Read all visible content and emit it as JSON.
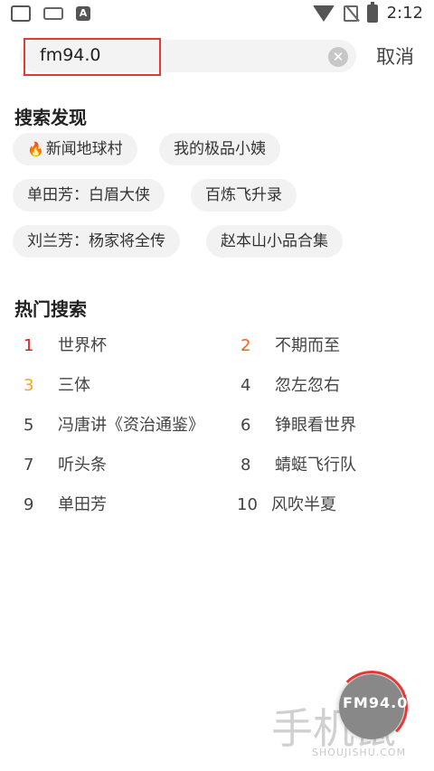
{
  "status_bar": {
    "time": "2:12",
    "left_icon_letter": "A"
  },
  "search": {
    "query": "fm94.0",
    "clear_glyph": "✕",
    "cancel_label": "取消"
  },
  "discover": {
    "title": "搜索发现",
    "chips": [
      "新闻地球村",
      "我的极品小姨",
      "单田芳：白眉大侠",
      "百炼飞升录",
      "刘兰芳：杨家将全传",
      "赵本山小品合集"
    ]
  },
  "hot": {
    "title": "热门搜索",
    "items": [
      {
        "rank": "1",
        "label": "世界杯"
      },
      {
        "rank": "2",
        "label": "不期而至"
      },
      {
        "rank": "3",
        "label": "三体"
      },
      {
        "rank": "4",
        "label": "忽左忽右"
      },
      {
        "rank": "5",
        "label": "冯唐讲《资治通鉴》"
      },
      {
        "rank": "6",
        "label": "铮眼看世界"
      },
      {
        "rank": "7",
        "label": "听头条"
      },
      {
        "rank": "8",
        "label": "蜻蜓飞行队"
      },
      {
        "rank": "9",
        "label": "单田芳"
      },
      {
        "rank": "10",
        "label": "风吹半夏"
      }
    ]
  },
  "player": {
    "logo_text": "FM94.0"
  },
  "watermark": {
    "main": "手机鼠",
    "sub": "SHOUJISHU.COM"
  },
  "colors": {
    "accent_red": "#e53935",
    "rank1": "#e02020",
    "rank2": "#ff5a1f",
    "rank3": "#f5a623"
  }
}
